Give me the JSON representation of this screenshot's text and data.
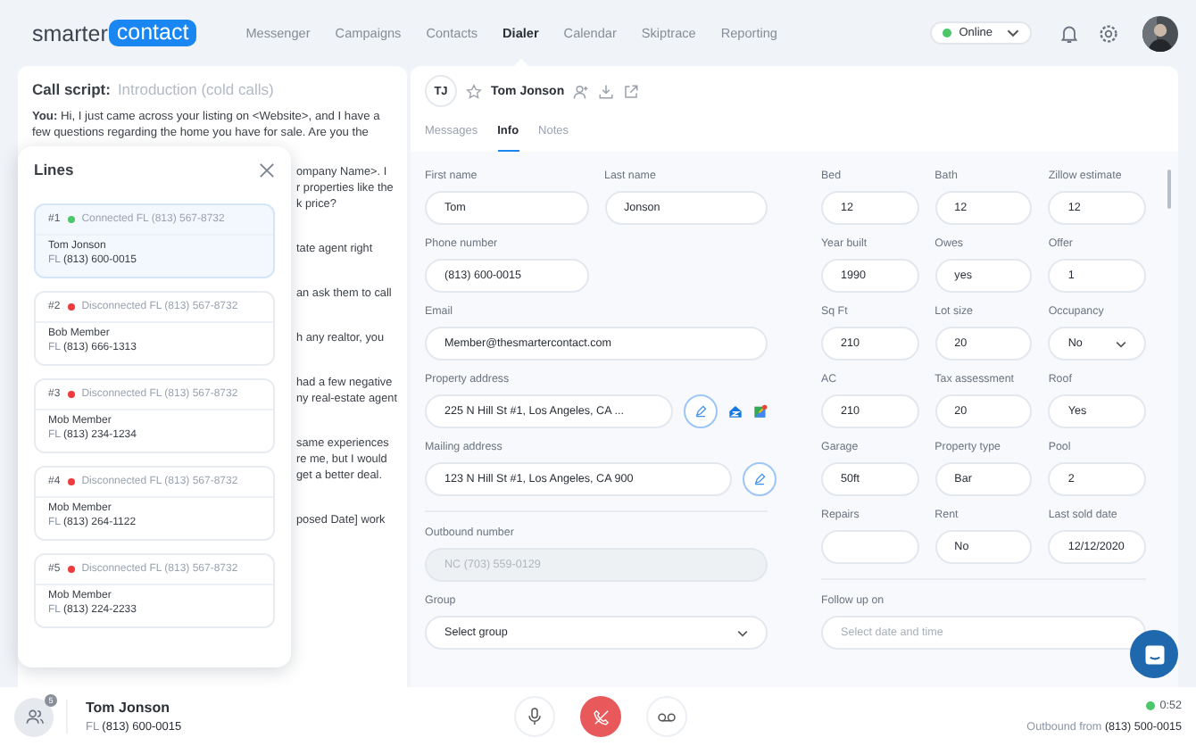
{
  "brand": {
    "part1": "smarter",
    "part2": "contact"
  },
  "nav": [
    {
      "label": "Messenger",
      "selected": false
    },
    {
      "label": "Campaigns",
      "selected": false
    },
    {
      "label": "Contacts",
      "selected": false
    },
    {
      "label": "Dialer",
      "selected": true
    },
    {
      "label": "Calendar",
      "selected": false
    },
    {
      "label": "Skiptrace",
      "selected": false
    },
    {
      "label": "Reporting",
      "selected": false
    }
  ],
  "status": {
    "label": "Online",
    "color": "#4cc86a"
  },
  "script": {
    "title": "Call script:",
    "name": "Introduction (cold calls)",
    "intro": "**You:** Hi, I just came across your listing on <Website>, and I have a few questions regarding the home you have for sale. Are you the",
    "fragments": [
      [
        "ompany Name>. I",
        "r properties like the",
        "k price?"
      ],
      [
        "tate agent right"
      ],
      [
        "an ask them to call"
      ],
      [
        "h any realtor, you"
      ],
      [
        "had a few negative",
        "ny real-estate agent"
      ],
      [
        "same experiences",
        "re me, but I would",
        "get a better deal."
      ],
      [
        "posed Date] work"
      ]
    ]
  },
  "lines": {
    "title": "Lines",
    "items": [
      {
        "index": "#1",
        "status": "Connected FL (813) 567-8732",
        "color": "#4cc86a",
        "selected": true,
        "name": "Tom Jonson",
        "state": "FL",
        "phone": "(813) 600-0015"
      },
      {
        "index": "#2",
        "status": "Disconnected FL (813) 567-8732",
        "color": "#ee3b3b",
        "selected": false,
        "name": "Bob  Member",
        "state": "FL",
        "phone": "(813) 666-1313"
      },
      {
        "index": "#3",
        "status": "Disconnected FL (813) 567-8732",
        "color": "#ee3b3b",
        "selected": false,
        "name": "Mob  Member",
        "state": "FL",
        "phone": "(813) 234-1234"
      },
      {
        "index": "#4",
        "status": "Disconnected FL (813) 567-8732",
        "color": "#ee3b3b",
        "selected": false,
        "name": "Mob  Member",
        "state": "FL",
        "phone": "(813) 264-1122"
      },
      {
        "index": "#5",
        "status": "Disconnected FL (813) 567-8732",
        "color": "#ee3b3b",
        "selected": false,
        "name": "Mob  Member",
        "state": "FL",
        "phone": "(813) 224-2233"
      }
    ]
  },
  "contact": {
    "initials": "TJ",
    "name": "Tom Jonson"
  },
  "tabs": [
    {
      "label": "Messages",
      "selected": false
    },
    {
      "label": "Info",
      "selected": true
    },
    {
      "label": "Notes",
      "selected": false
    }
  ],
  "left_form": [
    [
      {
        "label": "First name",
        "value": "Tom",
        "kind": "text"
      },
      {
        "label": "Last name",
        "value": "Jonson",
        "kind": "text"
      }
    ],
    [
      {
        "label": "Phone number",
        "value": "(813) 600-0015",
        "kind": "text"
      }
    ],
    [
      {
        "label": "Email",
        "value": "Member@thesmartercontact.com",
        "kind": "wide"
      }
    ],
    [
      {
        "label": "Property address",
        "value": "225 N Hill St #1, Los Angeles, CA ...",
        "kind": "address",
        "links": true
      }
    ],
    [
      {
        "label": "Mailing address",
        "value": "123 N Hill St #1, Los Angeles, CA 900",
        "kind": "address",
        "links": false
      }
    ],
    [
      {
        "label": "Outbound number",
        "value": "NC (703) 559-0129",
        "kind": "disabled"
      }
    ],
    [
      {
        "label": "Group",
        "value": "Select group",
        "kind": "select"
      }
    ]
  ],
  "right_form": [
    [
      {
        "label": "Bed",
        "value": "12",
        "kind": "text"
      },
      {
        "label": "Bath",
        "value": "12",
        "kind": "text"
      },
      {
        "label": "Zillow estimate",
        "value": "12",
        "kind": "text"
      }
    ],
    [
      {
        "label": "Year built",
        "value": "1990",
        "kind": "text"
      },
      {
        "label": "Owes",
        "value": "yes",
        "kind": "text"
      },
      {
        "label": "Offer",
        "value": "1",
        "kind": "text"
      }
    ],
    [
      {
        "label": "Sq Ft",
        "value": "210",
        "kind": "text"
      },
      {
        "label": "Lot size",
        "value": "20",
        "kind": "text"
      },
      {
        "label": "Occupancy",
        "value": "No",
        "kind": "select"
      }
    ],
    [
      {
        "label": "AC",
        "value": "210",
        "kind": "text"
      },
      {
        "label": "Tax assessment",
        "value": "20",
        "kind": "text"
      },
      {
        "label": "Roof",
        "value": "Yes",
        "kind": "text"
      }
    ],
    [
      {
        "label": "Garage",
        "value": "50ft",
        "kind": "text"
      },
      {
        "label": "Property type",
        "value": "Bar",
        "kind": "text"
      },
      {
        "label": "Pool",
        "value": "2",
        "kind": "text"
      }
    ],
    [
      {
        "label": "Repairs",
        "kind": "text"
      },
      {
        "label": "Rent",
        "value": "No",
        "kind": "text"
      },
      {
        "label": "Last sold date",
        "value": "12/12/2020",
        "kind": "text"
      }
    ],
    [
      {
        "label": "Follow up on",
        "placeholder": "Select date and time",
        "kind": "wide"
      }
    ]
  ],
  "call": {
    "badge": "5",
    "name": "Tom Jonson",
    "state": "FL",
    "phone": "(813) 600-0015",
    "timer": "0:52",
    "connected": true,
    "outbound_label": "Outbound from",
    "outbound_number": "(813) 500-0015"
  }
}
